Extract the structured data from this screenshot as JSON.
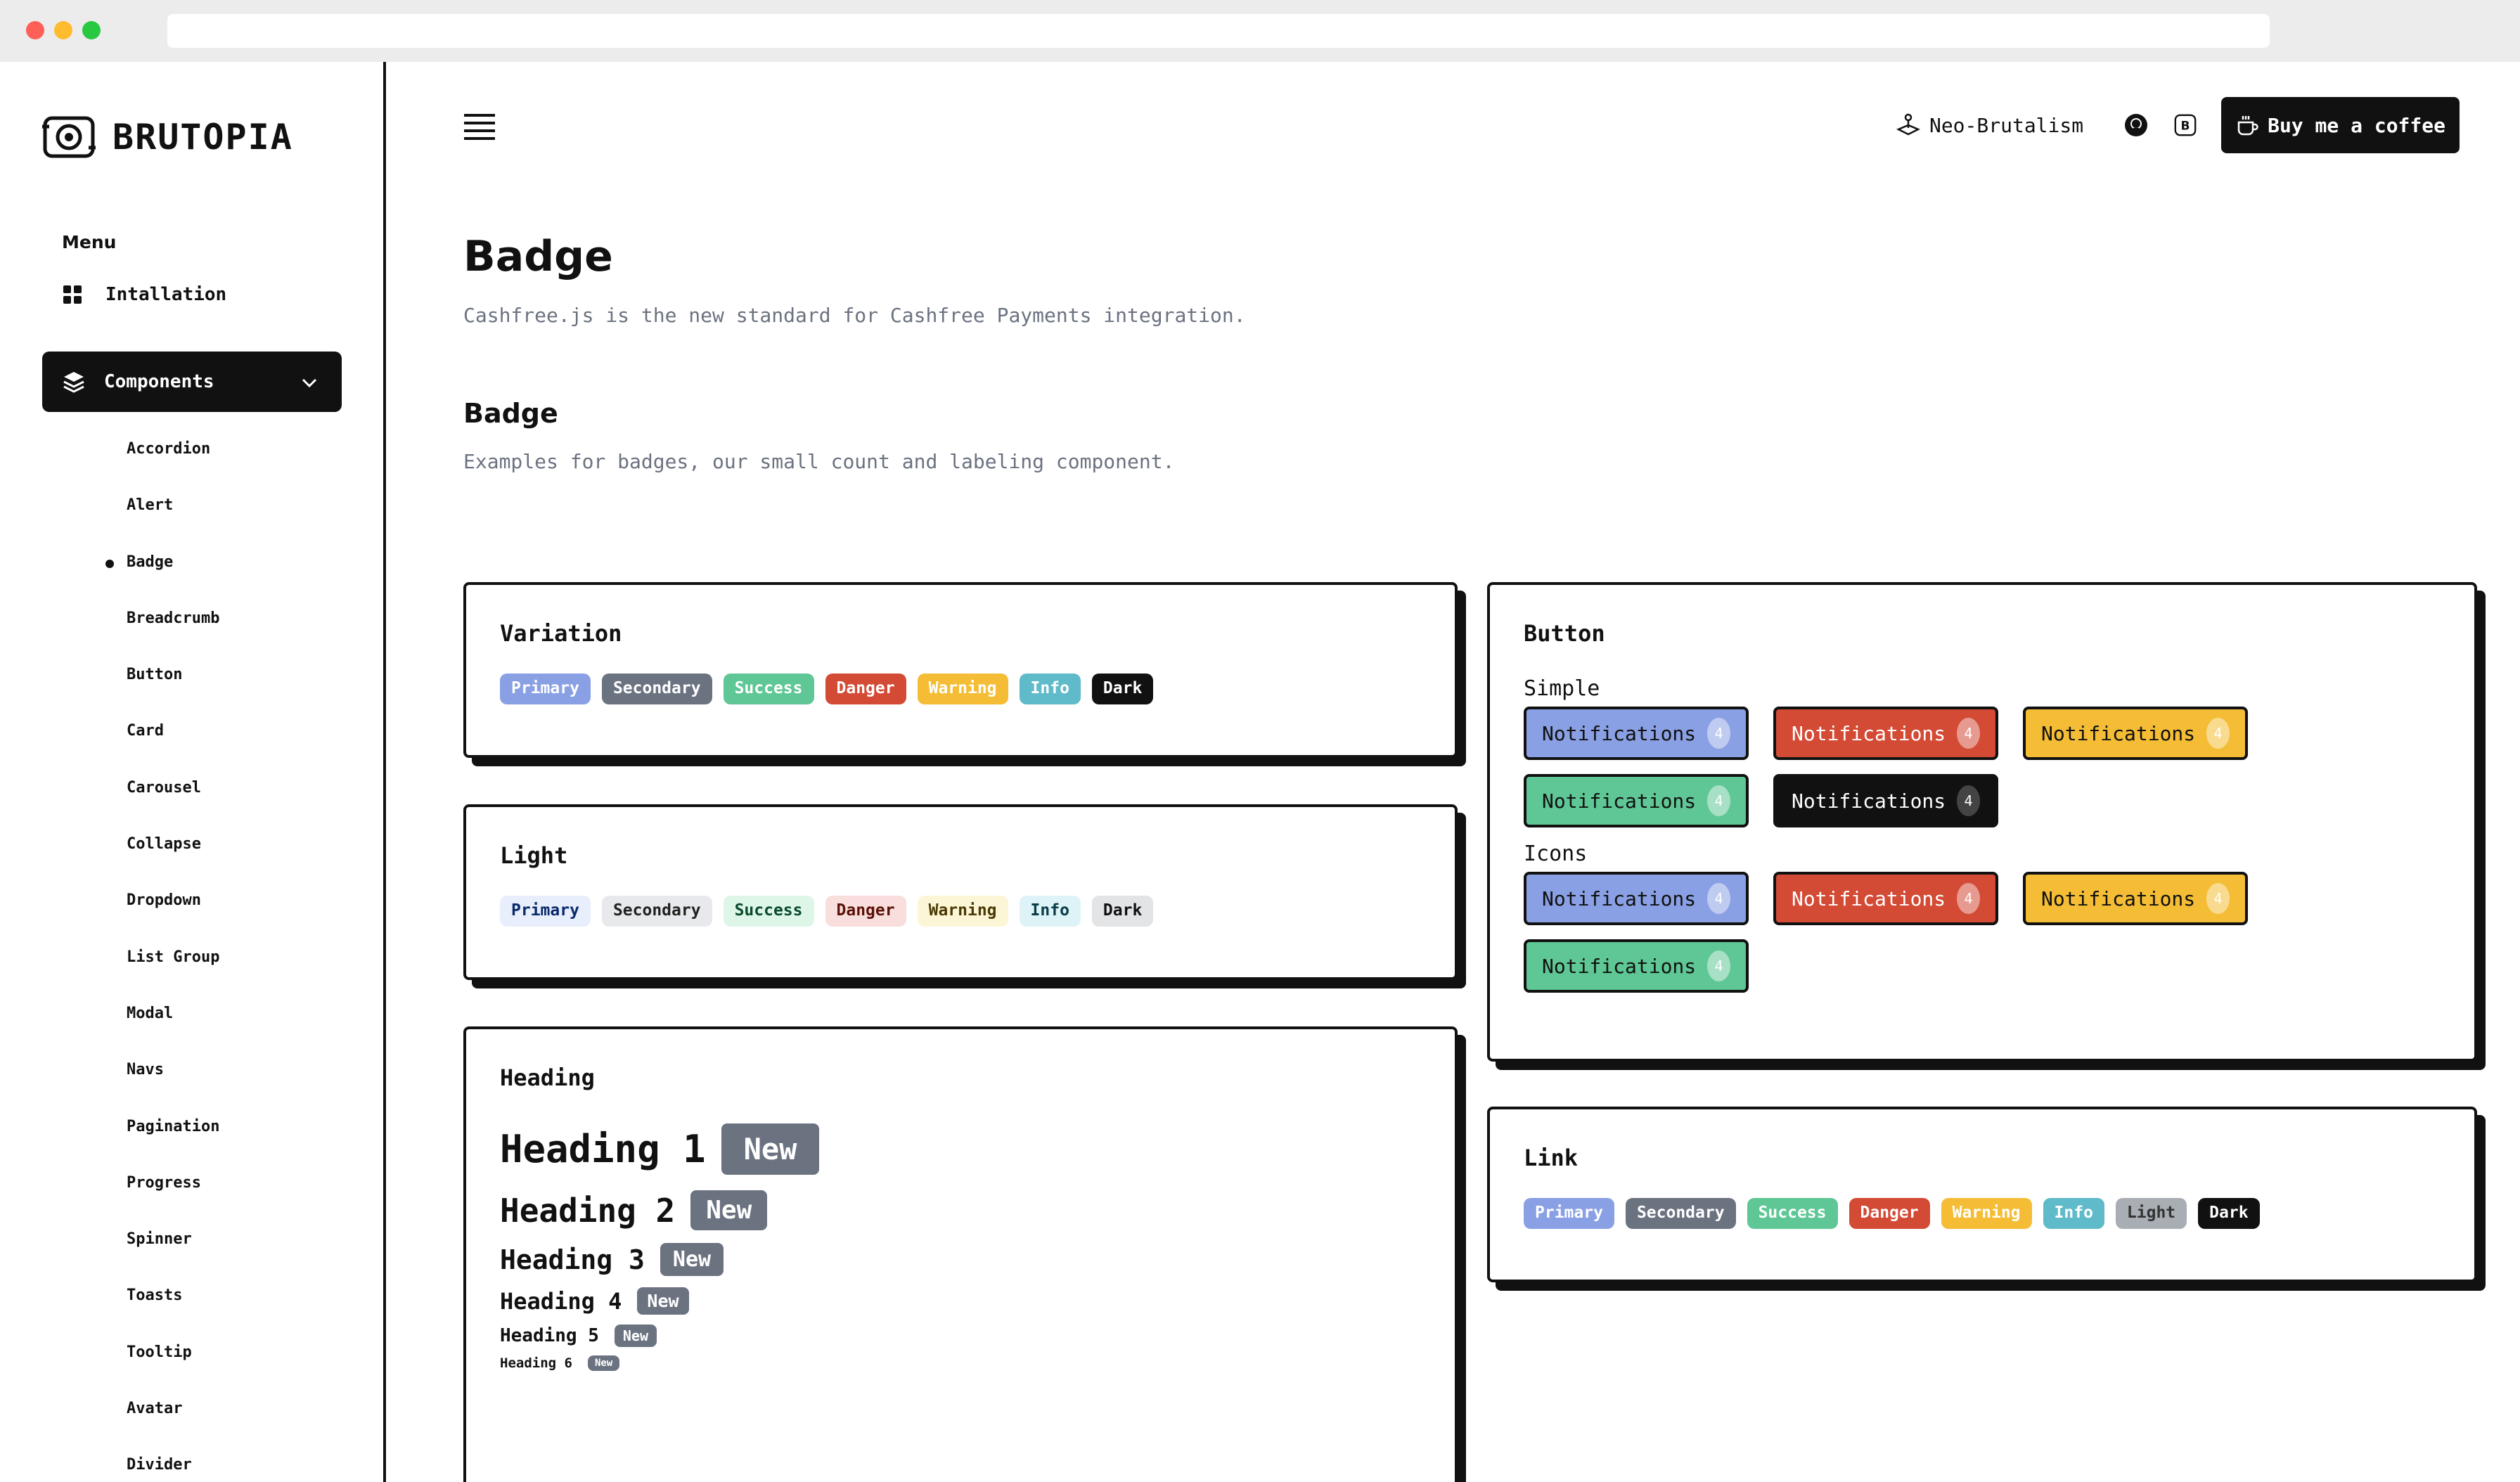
{
  "brand": {
    "name": "BRUTOPIA"
  },
  "sidebar": {
    "menu_heading": "Menu",
    "installation_label": "Intallation",
    "components_label": "Components",
    "items": [
      {
        "label": "Accordion"
      },
      {
        "label": "Alert"
      },
      {
        "label": "Badge",
        "active": true
      },
      {
        "label": "Breadcrumb"
      },
      {
        "label": "Button"
      },
      {
        "label": "Card"
      },
      {
        "label": "Carousel"
      },
      {
        "label": "Collapse"
      },
      {
        "label": "Dropdown"
      },
      {
        "label": "List Group"
      },
      {
        "label": "Modal"
      },
      {
        "label": "Navs"
      },
      {
        "label": "Pagination"
      },
      {
        "label": "Progress"
      },
      {
        "label": "Spinner"
      },
      {
        "label": "Toasts"
      },
      {
        "label": "Tooltip"
      },
      {
        "label": "Avatar"
      },
      {
        "label": "Divider"
      }
    ]
  },
  "topbar": {
    "theme_label": "Neo-Brutalism",
    "coffee_label": "Buy me a coffee",
    "icons": [
      "menu-icon",
      "joystick-icon",
      "github-icon",
      "bootstrap-icon",
      "coffee-icon"
    ]
  },
  "page": {
    "title": "Badge",
    "subtitle": "Cashfree.js is the new standard for Cashfree Payments integration.",
    "section_title": "Badge",
    "section_subtitle": "Examples for badges, our small count and labeling component."
  },
  "cards": {
    "variation": {
      "title": "Variation",
      "badges": [
        "Primary",
        "Secondary",
        "Success",
        "Danger",
        "Warning",
        "Info",
        "Dark"
      ]
    },
    "light": {
      "title": "Light",
      "badges": [
        "Primary",
        "Secondary",
        "Success",
        "Danger",
        "Warning",
        "Info",
        "Dark"
      ]
    },
    "heading": {
      "title": "Heading",
      "rows": [
        {
          "text": "Heading 1",
          "badge": "New"
        },
        {
          "text": "Heading 2",
          "badge": "New"
        },
        {
          "text": "Heading 3",
          "badge": "New"
        },
        {
          "text": "Heading 4",
          "badge": "New"
        },
        {
          "text": "Heading 5",
          "badge": "New"
        },
        {
          "text": "Heading 6",
          "badge": "New"
        }
      ]
    },
    "button": {
      "title": "Button",
      "simple_label": "Simple",
      "icons_label": "Icons",
      "simple": [
        {
          "label": "Notifications",
          "count": "4",
          "variant": "primary"
        },
        {
          "label": "Notifications",
          "count": "4",
          "variant": "danger"
        },
        {
          "label": "Notifications",
          "count": "4",
          "variant": "warning"
        },
        {
          "label": "Notifications",
          "count": "4",
          "variant": "success"
        },
        {
          "label": "Notifications",
          "count": "4",
          "variant": "dark"
        }
      ],
      "icons": [
        {
          "label": "Notifications",
          "count": "4",
          "variant": "primary"
        },
        {
          "label": "Notifications",
          "count": "4",
          "variant": "danger"
        },
        {
          "label": "Notifications",
          "count": "4",
          "variant": "warning"
        },
        {
          "label": "Notifications",
          "count": "4",
          "variant": "success"
        }
      ]
    },
    "link": {
      "title": "Link",
      "badges": [
        "Primary",
        "Secondary",
        "Success",
        "Danger",
        "Warning",
        "Info",
        "Light",
        "Dark"
      ]
    }
  },
  "colors": {
    "primary": "#8aa0e4",
    "secondary": "#6b7280",
    "success": "#5fc795",
    "danger": "#d34a35",
    "warning": "#f4bd35",
    "info": "#5fbac9",
    "dark": "#111111"
  }
}
